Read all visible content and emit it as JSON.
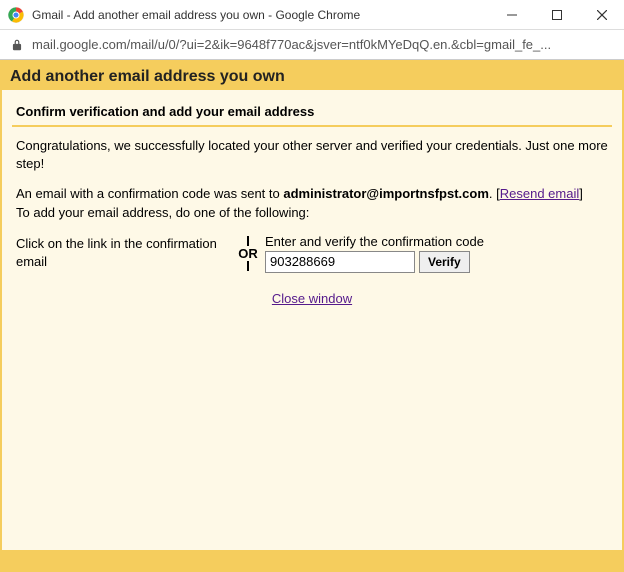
{
  "window": {
    "title": "Gmail - Add another email address you own - Google Chrome"
  },
  "addressbar": {
    "url": "mail.google.com/mail/u/0/?ui=2&ik=9648f770ac&jsver=ntf0kMYeDqQ.en.&cbl=gmail_fe_..."
  },
  "page": {
    "banner_title": "Add another email address you own",
    "section_title": "Confirm verification and add your email address",
    "congrats": "Congratulations, we successfully located your other server and verified your credentials. Just one more step!",
    "sent_prefix": "An email with a confirmation code was sent to ",
    "sent_email": "administrator@importnsfpst.com",
    "sent_suffix_period": ". ",
    "resend_bracket_open": "[",
    "resend_label": "Resend email",
    "resend_bracket_close": "]",
    "todo_line": "To add your email address, do one of the following:",
    "left_instruction": "Click on the link in the confirmation email",
    "or_label": "OR",
    "right_instruction": "Enter and verify the confirmation code",
    "code_value": "903288669",
    "verify_label": "Verify",
    "close_label": "Close window"
  }
}
